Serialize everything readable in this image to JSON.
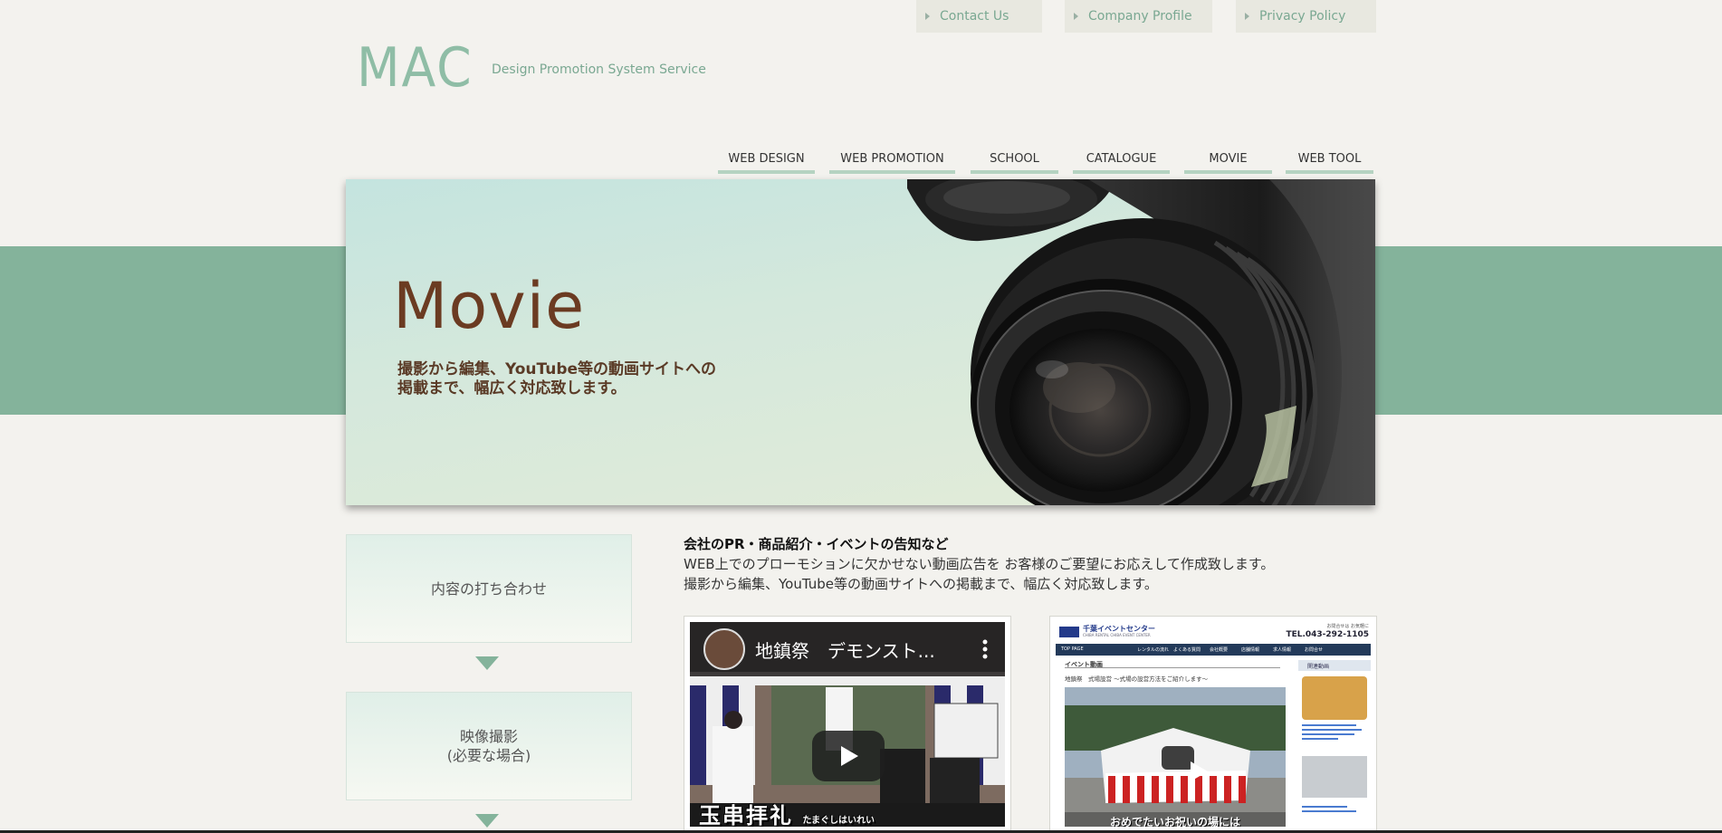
{
  "top_links": [
    {
      "label": "Contact Us"
    },
    {
      "label": "Company Profile"
    },
    {
      "label": "Privacy Policy"
    }
  ],
  "logo": {
    "name": "MAC",
    "tagline": "Design Promotion System Service"
  },
  "nav": [
    {
      "label": "WEB DESIGN"
    },
    {
      "label": "WEB PROMOTION"
    },
    {
      "label": "SCHOOL"
    },
    {
      "label": "CATALOGUE"
    },
    {
      "label": "MOVIE"
    },
    {
      "label": "WEB TOOL"
    }
  ],
  "hero": {
    "title": "Movie",
    "line1": "撮影から編集、YouTube等の動画サイトへの",
    "line2": "掲載まで、幅広く対応致します。"
  },
  "steps": [
    {
      "line1": "内容の打ち合わせ",
      "line2": ""
    },
    {
      "line1": "映像撮影",
      "line2": "(必要な場合)"
    }
  ],
  "content": {
    "lead": "会社のPR・商品紹介・イベントの告知など",
    "line1": "WEB上でのプローモションに欠かせない動画広告を お客様のご要望にお応えして作成致します。",
    "line2": "撮影から編集、YouTube等の動画サイトへの掲載まで、幅広く対応致します。"
  },
  "video1": {
    "title": "地鎮祭　デモンスト...",
    "caption": "玉串拝礼",
    "caption_small": "たまぐしはいれい"
  },
  "video2": {
    "site_name": "千葉イベントセンター",
    "site_sub": "CHIBA RENTAL CHIBA EVENT CENTER",
    "phone_label": "お問合せは お気軽に",
    "phone": "TEL.043-292-1105",
    "menu": [
      "TOP PAGE",
      "レンタルの流れ",
      "よくある質問",
      "会社概要",
      "店舗情報",
      "求人情報",
      "お問合せ"
    ],
    "section": "イベント動画",
    "headline": "地鎮祭　式場設営 ～式場の設営方法をご紹介します～",
    "side_title": "関連動画",
    "caption": "おめでたいお祝いの場には"
  },
  "colors": {
    "accent": "#84b39b",
    "link": "#7aa892",
    "hero_title": "#6b3b22"
  }
}
